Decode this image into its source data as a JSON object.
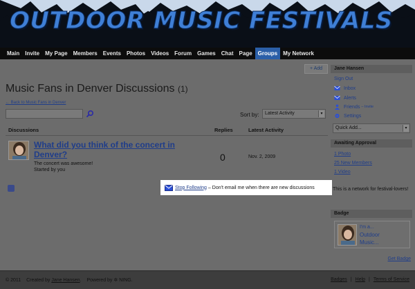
{
  "site": {
    "title": "OUTDOOR MUSIC FESTIVALS"
  },
  "nav": {
    "items": [
      {
        "label": "Main"
      },
      {
        "label": "Invite"
      },
      {
        "label": "My Page"
      },
      {
        "label": "Members"
      },
      {
        "label": "Events"
      },
      {
        "label": "Photos"
      },
      {
        "label": "Videos"
      },
      {
        "label": "Forum"
      },
      {
        "label": "Games"
      },
      {
        "label": "Chat"
      },
      {
        "label": "Page"
      },
      {
        "label": "Groups",
        "active": true
      },
      {
        "label": "My Network"
      }
    ]
  },
  "main": {
    "add_label": "+ Add",
    "heading": "Music Fans in Denver Discussions",
    "heading_count": "(1)",
    "back_link": "← Back to Music Fans in Denver",
    "search_value": "",
    "sort_label": "Sort by:",
    "sort_value": "Latest Activity",
    "columns": [
      "Discussions",
      "Replies",
      "Latest Activity"
    ],
    "discussion": {
      "title": "What did you think of the concert in Denver?",
      "excerpt": "The concert was awesome!",
      "started_by": "Started by you",
      "replies": "0",
      "latest": "Nov. 2, 2009"
    },
    "follow": {
      "link": "Stop Following",
      "text": "– Don't email me when there are new discussions"
    }
  },
  "sidebar": {
    "user_name": "Jane Hansen",
    "sign_out": "Sign Out",
    "inbox": "Inbox",
    "alerts": "Alerts",
    "friends": "Friends",
    "friends_invite": "– Invite",
    "settings": "Settings",
    "quick_add": "Quick Add...",
    "approval_head": "Awaiting Approval",
    "approval_photo": "1 Photo",
    "approval_members": "25 New Members",
    "approval_video": "1 Video",
    "about": "This is a network for festival-lovers!",
    "badge_head": "Badge",
    "badge_line1": "I'm a...",
    "badge_line2": "Outdoor",
    "badge_line3": "Music...",
    "get_badge": "Get Badge"
  },
  "footer": {
    "copyright": "© 2011",
    "created_by_label": "Created by",
    "creator": "Jane Hansen",
    "powered_by": "Powered by",
    "ning": "NING.",
    "badges": "Badges",
    "help": "Help",
    "terms": "Terms of Service"
  },
  "colors": {
    "accent": "#2b5fa8",
    "link": "#1f3d8a",
    "highlight": "#ffffff"
  }
}
